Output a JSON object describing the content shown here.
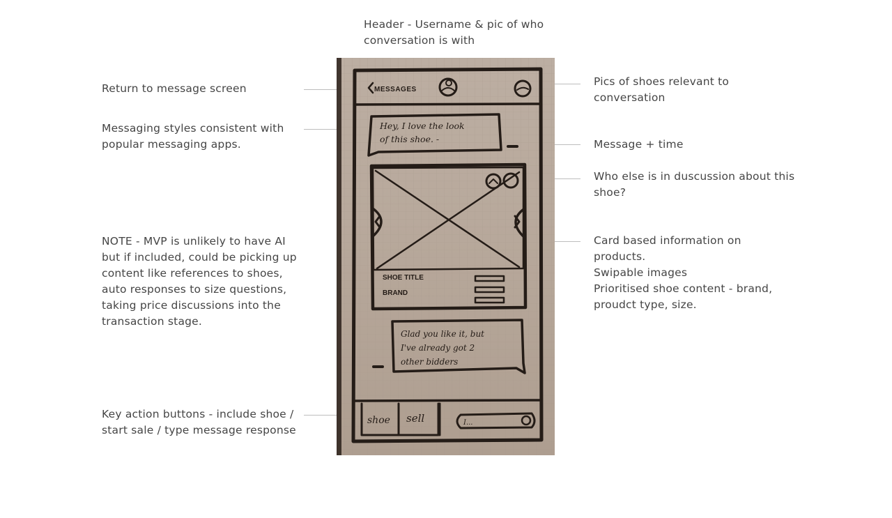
{
  "annotations": {
    "header": "Header - Username & pic of who\nconversation is with",
    "return": "Return to message screen",
    "messaging_styles": "Messaging styles consistent with\npopular messaging apps.",
    "note_mvp": "NOTE - MVP is unlikely to have AI\nbut if included, could be picking up\ncontent like references to shoes,\nauto responses to size questions,\ntaking price discussions into the\ntransaction stage.",
    "key_actions": "Key action buttons - include shoe /\nstart sale / type message response",
    "pics_shoes": "Pics of shoes relevant to\nconversation",
    "message_time": "Message  + time",
    "who_else": "Who else is in duscussion about this\nshoe?",
    "card_info": "Card based information on\nproducts.\nSwipable images\nPrioritised shoe content - brand,\nproudct type, size."
  },
  "sketch": {
    "back_label": "MESSAGES",
    "bubble_in_line1": "Hey, I love the look",
    "bubble_in_line2": "of this shoe. -",
    "card_title": "SHOE TITLE",
    "card_brand": "BRAND",
    "bubble_out_line1": "Glad you like it, but",
    "bubble_out_line2": "I've already got 2",
    "bubble_out_line3": "other bidders",
    "btn_shoe": "shoe",
    "btn_sell": "sell",
    "input_text": "I..."
  },
  "colors": {
    "paper": "#b8a99c",
    "ink": "#241c17",
    "annotation_text": "#454545",
    "connector": "#bdbdbd"
  }
}
